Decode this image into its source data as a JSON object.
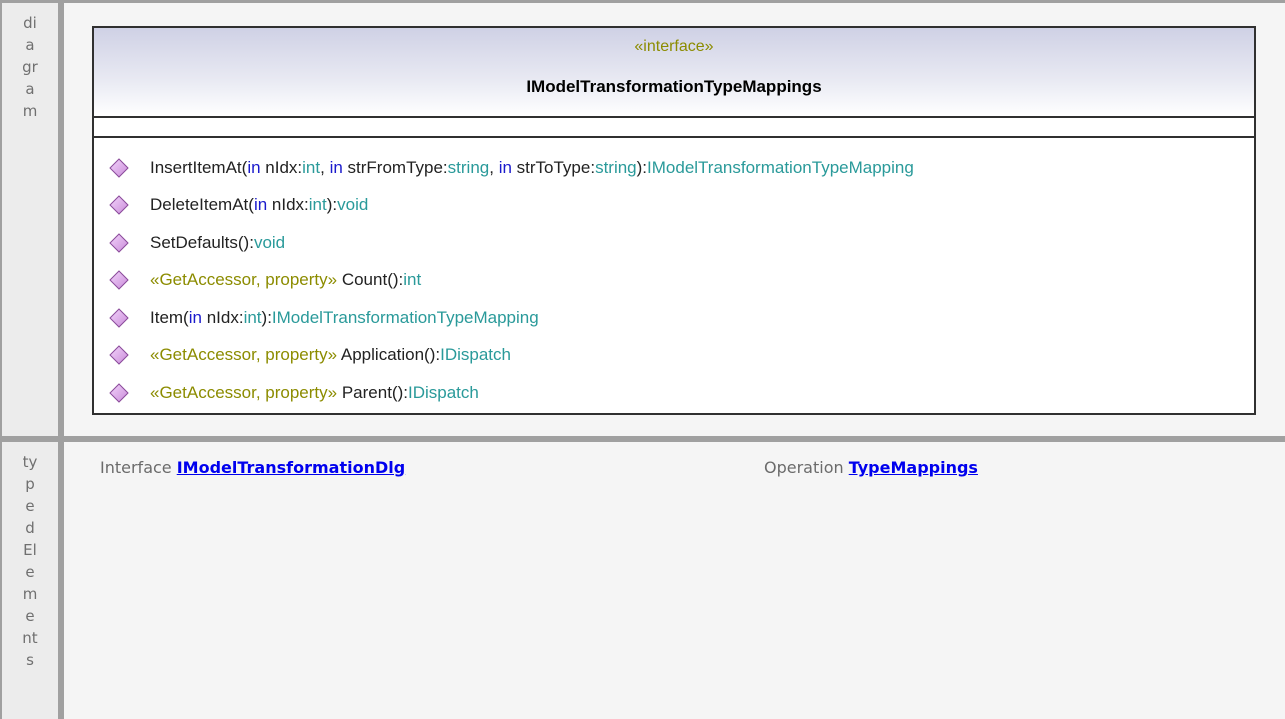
{
  "diagram_label": [
    "di",
    "a",
    "gr",
    "a",
    "m"
  ],
  "typed_label": [
    "ty",
    "p",
    "e",
    "d",
    "El",
    "e",
    "m",
    "e",
    "nt",
    "s"
  ],
  "uml": {
    "stereotype": "«interface»",
    "name": "IModelTransformationTypeMappings",
    "operations": [
      {
        "parts": [
          {
            "t": "InsertItemAt(",
            "c": ""
          },
          {
            "t": "in",
            "c": "kw"
          },
          {
            "t": " nIdx:",
            "c": ""
          },
          {
            "t": "int",
            "c": "ty"
          },
          {
            "t": ", ",
            "c": ""
          },
          {
            "t": "in",
            "c": "kw"
          },
          {
            "t": " strFromType:",
            "c": ""
          },
          {
            "t": "string",
            "c": "ty"
          },
          {
            "t": ", ",
            "c": ""
          },
          {
            "t": "in",
            "c": "kw"
          },
          {
            "t": " strToType:",
            "c": ""
          },
          {
            "t": "string",
            "c": "ty"
          },
          {
            "t": "):",
            "c": ""
          },
          {
            "t": "IModelTransformationTypeMapping",
            "c": "ty"
          }
        ]
      },
      {
        "parts": [
          {
            "t": "DeleteItemAt(",
            "c": ""
          },
          {
            "t": "in",
            "c": "kw"
          },
          {
            "t": " nIdx:",
            "c": ""
          },
          {
            "t": "int",
            "c": "ty"
          },
          {
            "t": "):",
            "c": ""
          },
          {
            "t": "void",
            "c": "ty"
          }
        ]
      },
      {
        "parts": [
          {
            "t": "SetDefaults():",
            "c": ""
          },
          {
            "t": "void",
            "c": "ty"
          }
        ]
      },
      {
        "parts": [
          {
            "t": "«GetAccessor, property» ",
            "c": "st"
          },
          {
            "t": "Count():",
            "c": ""
          },
          {
            "t": "int",
            "c": "ty"
          }
        ]
      },
      {
        "parts": [
          {
            "t": "Item(",
            "c": ""
          },
          {
            "t": "in",
            "c": "kw"
          },
          {
            "t": " nIdx:",
            "c": ""
          },
          {
            "t": "int",
            "c": "ty"
          },
          {
            "t": "):",
            "c": ""
          },
          {
            "t": "IModelTransformationTypeMapping",
            "c": "ty"
          }
        ]
      },
      {
        "parts": [
          {
            "t": "«GetAccessor, property» ",
            "c": "st"
          },
          {
            "t": "Application():",
            "c": ""
          },
          {
            "t": "IDispatch",
            "c": "ty"
          }
        ]
      },
      {
        "parts": [
          {
            "t": "«GetAccessor, property» ",
            "c": "st"
          },
          {
            "t": "Parent():",
            "c": ""
          },
          {
            "t": "IDispatch",
            "c": "ty"
          }
        ]
      }
    ]
  },
  "typed_elements": {
    "interface_prefix": "Interface ",
    "interface_link": "IModelTransformationDlg",
    "operation_prefix": "Operation ",
    "operation_link": "TypeMappings"
  },
  "colors": {
    "keyword": "#1a1acc",
    "type": "#2a9a9a",
    "stereotype": "#8c8c00",
    "operation_icon": "#c98ad9"
  }
}
